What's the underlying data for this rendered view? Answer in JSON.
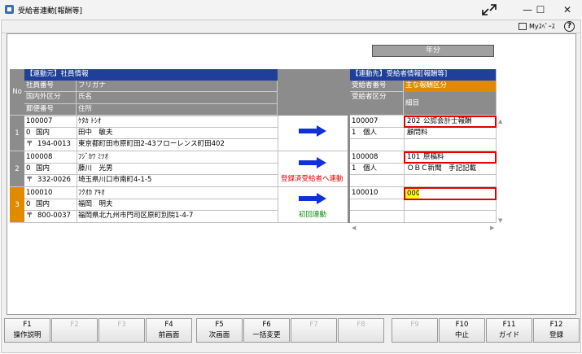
{
  "window": {
    "title": "受給者連動[報酬等]",
    "min_glyph": "—",
    "max_glyph": "☐",
    "close_glyph": "✕"
  },
  "toolbar": {
    "myspace_label": "Myｽﾍﾟｰｽ",
    "help_glyph": "?"
  },
  "year_button": "年分",
  "left_header": {
    "group": "【連動元】社員情報",
    "no": "No",
    "employee_no": "社員番号",
    "furigana": "フリガナ",
    "domestic": "国内外区分",
    "name": "氏名",
    "postal": "郵便番号",
    "address": "住所"
  },
  "right_header": {
    "group": "【連動先】受給者情報[報酬等]",
    "recipient_no": "受給者番号",
    "main_category": "主な報酬区分",
    "recipient_category": "受給者区分",
    "detail": "細目"
  },
  "rows": [
    {
      "no": "1",
      "employee_no": "100007",
      "furigana": "ｹﾀｶ ﾄｼｵ",
      "domestic_code": "0",
      "domestic_label": "国内",
      "name": "田中　敏夫",
      "postal_mark": "〒",
      "postal": "194-0013",
      "address": "東京都町田市原町田2-43フローレンス町田402",
      "action_label": "",
      "recipient_no": "100007",
      "category_code": "1",
      "category_label": "個人",
      "main_code": "202",
      "main_label": "公認会計士報酬",
      "detail": "顧問料"
    },
    {
      "no": "2",
      "employee_no": "100008",
      "furigana": "ﾌｼﾞｶﾜ ﾐﾂｵ",
      "domestic_code": "0",
      "domestic_label": "国内",
      "name": "藤川　光男",
      "postal_mark": "〒",
      "postal": "332-0026",
      "address": "埼玉県川口市南町4-1-5",
      "action_label": "登録済受給者へ連動",
      "recipient_no": "100008",
      "category_code": "1",
      "category_label": "個人",
      "main_code": "101",
      "main_label": "原稿料",
      "detail": "ＯＢＣ新聞　手記記載"
    },
    {
      "no": "3",
      "employee_no": "100010",
      "furigana": "ﾌｸｵｶ ｱｷｵ",
      "domestic_code": "0",
      "domestic_label": "国内",
      "name": "福岡　明夫",
      "postal_mark": "〒",
      "postal": "800-0037",
      "address": "福岡県北九州市門司区原町別院1-4-7",
      "action_label": "初回連動",
      "recipient_no": "100010",
      "category_code": "",
      "category_label": "",
      "main_code": "000",
      "main_label": "",
      "detail": ""
    }
  ],
  "colors": {
    "accent_orange": "#e08a00",
    "header_blue": "#1f3f9a",
    "arrow_blue": "#1030d8",
    "highlight_red": "#e00000"
  },
  "fkeys": [
    {
      "key": "F1",
      "label": "操作説明",
      "enabled": true
    },
    {
      "key": "F2",
      "label": "",
      "enabled": false
    },
    {
      "key": "F3",
      "label": "",
      "enabled": false
    },
    {
      "key": "F4",
      "label": "前画面",
      "enabled": true
    },
    {
      "key": "F5",
      "label": "次画面",
      "enabled": true
    },
    {
      "key": "F6",
      "label": "一括変更",
      "enabled": true
    },
    {
      "key": "F7",
      "label": "",
      "enabled": false
    },
    {
      "key": "F8",
      "label": "",
      "enabled": false
    },
    {
      "key": "F9",
      "label": "",
      "enabled": false
    },
    {
      "key": "F10",
      "label": "中止",
      "enabled": true
    },
    {
      "key": "F11",
      "label": "ガイド",
      "enabled": true
    },
    {
      "key": "F12",
      "label": "登録",
      "enabled": true
    }
  ]
}
